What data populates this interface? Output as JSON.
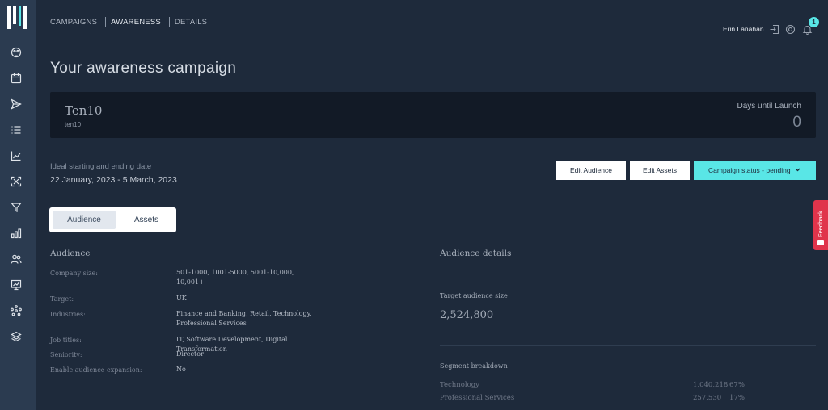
{
  "colors": {
    "sidebar": "#2b3b50",
    "background": "#1e2a3b",
    "accent": "#59e6e6",
    "feedback": "#e0344b"
  },
  "sidebar": {
    "logo_icon": "brand-bars-logo",
    "items": [
      {
        "icon": "palette-icon"
      },
      {
        "icon": "calendar-icon"
      },
      {
        "icon": "send-icon"
      },
      {
        "icon": "list-icon"
      },
      {
        "icon": "chart-growth-icon"
      },
      {
        "icon": "expand-icon"
      },
      {
        "icon": "filter-icon"
      },
      {
        "icon": "bar-chart-icon"
      },
      {
        "icon": "users-icon"
      },
      {
        "icon": "presentation-icon"
      },
      {
        "icon": "network-icon"
      },
      {
        "icon": "layers-icon"
      }
    ]
  },
  "breadcrumb": {
    "campaigns": "CAMPAIGNS",
    "awareness": "AWARENESS",
    "details": "DETAILS"
  },
  "header": {
    "user_name": "Erin Lanahan",
    "notification_count": "1"
  },
  "page": {
    "title": "Your awareness campaign"
  },
  "banner": {
    "name": "Ten10",
    "sub": "ten10",
    "days_label": "Days until Launch",
    "days_value": "0"
  },
  "dates": {
    "label": "Ideal starting and ending date",
    "value": "22 January, 2023 - 5 March, 2023"
  },
  "actions": {
    "edit_audience": "Edit Audience",
    "edit_assets": "Edit Assets",
    "status": "Campaign status - pending"
  },
  "tabs": {
    "audience": "Audience",
    "assets": "Assets"
  },
  "audience": {
    "title": "Audience",
    "rows": [
      {
        "label": "Company size:",
        "value": "501-1000, 1001-5000, 5001-10,000, 10,001+"
      },
      {
        "label": "Target:",
        "value": "UK"
      },
      {
        "label": "Industries:",
        "value": "Finance and Banking, Retail, Technology, Professional Services"
      },
      {
        "label": "Job titles:",
        "value": "IT, Software Development, Digital Transformation"
      },
      {
        "label": "Seniority:",
        "value": "Director"
      },
      {
        "label": "Enable audience expansion:",
        "value": "No"
      }
    ]
  },
  "details": {
    "title": "Audience details",
    "target_label": "Target audience size",
    "target_value": "2,524,800",
    "segment_label": "Segment breakdown",
    "segments": [
      {
        "name": "Technology",
        "count": "1,040,218",
        "pct": "67%"
      },
      {
        "name": "Professional Services",
        "count": "257,530",
        "pct": "17%"
      }
    ]
  },
  "feedback": {
    "label": "Feedback"
  }
}
